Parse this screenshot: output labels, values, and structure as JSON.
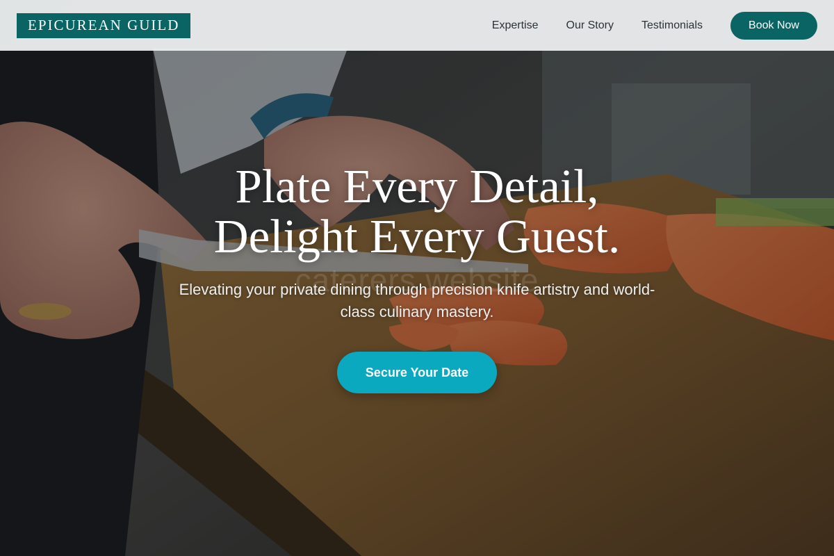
{
  "brand": {
    "name": "EPICUREAN GUILD",
    "color": "#0b6464"
  },
  "nav": {
    "links": [
      "Expertise",
      "Our Story",
      "Testimonials"
    ],
    "cta_label": "Book Now"
  },
  "hero": {
    "title_line1": "Plate Every Detail,",
    "title_line2": "Delight Every Guest.",
    "subtitle": "Elevating your private dining through precision knife artistry and world-class culinary mastery.",
    "cta_label": "Secure Your Date",
    "cta_color": "#0aa9bf",
    "watermark": "caterers website"
  }
}
